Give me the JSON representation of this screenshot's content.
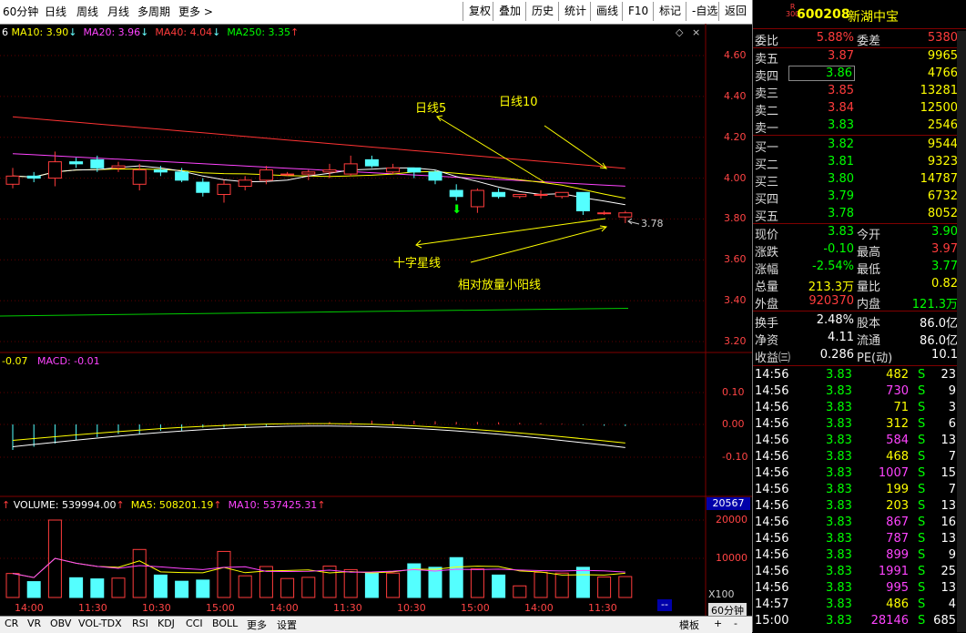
{
  "toolbar": {
    "left": [
      "60分钟",
      "日线",
      "周线",
      "月线",
      "多周期",
      "更多 >"
    ],
    "right": [
      "复权",
      "叠加",
      "历史",
      "统计",
      "画线",
      "F10",
      "标记",
      "-自选",
      "返回"
    ]
  },
  "indicators": {
    "ma_prefix": "6",
    "ma10": "MA10: 3.90",
    "ma20": "MA20: 3.96",
    "ma40": "MA40: 4.04",
    "ma250": "MA250: 3.35",
    "macd_left": "-0.07",
    "macd": "MACD: -0.01",
    "volume": "VOLUME: 539994.00",
    "vma5": "MA5: 508201.19",
    "vma10": "MA10: 537425.31",
    "vol_box": "20567",
    "x100": "X100",
    "period_btn": "60分钟"
  },
  "annotations": {
    "rixian5": "日线5",
    "rixian10": "日线10",
    "shizixing": "十字星线",
    "xiaoyang": "相对放量小阳线",
    "low_label": "3.78"
  },
  "price_axis": [
    "4.60",
    "4.40",
    "4.20",
    "4.00",
    "3.80",
    "3.60",
    "3.40",
    "3.20"
  ],
  "macd_axis": [
    "0.10",
    "0.00",
    "-0.10"
  ],
  "vol_axis": [
    "20000",
    "10000"
  ],
  "time_axis": [
    "14:00",
    "11:30",
    "10:30",
    "15:00",
    "14:00",
    "11:30",
    "10:30",
    "15:00",
    "14:00",
    "11:30"
  ],
  "bottom_tabs": [
    "CR",
    "VR",
    "OBV",
    "VOL-TDX",
    "RSI",
    "KDJ",
    "CCI",
    "BOLL",
    "更多",
    "设置"
  ],
  "bottom_right": [
    "模板",
    "+",
    "-"
  ],
  "colors": {
    "up": "#ff3c3c",
    "down": "#54ffff",
    "ma5": "#ffffff",
    "ma10": "#ffff00",
    "ma20": "#ff44ff",
    "ma40": "#ff3333",
    "ma250": "#00cc00"
  },
  "chart_data": {
    "type": "candlestick",
    "unit": "price (CNY)",
    "ylim": [
      3.2,
      4.6
    ],
    "candles": [
      {
        "o": 3.97,
        "c": 4.01,
        "h": 4.05,
        "l": 3.95
      },
      {
        "o": 4.01,
        "c": 4.0,
        "h": 4.03,
        "l": 3.98
      },
      {
        "o": 4.0,
        "c": 4.08,
        "h": 4.13,
        "l": 3.96
      },
      {
        "o": 4.08,
        "c": 4.07,
        "h": 4.1,
        "l": 4.05
      },
      {
        "o": 4.09,
        "c": 4.05,
        "h": 4.11,
        "l": 4.03
      },
      {
        "o": 4.05,
        "c": 4.06,
        "h": 4.08,
        "l": 4.03
      },
      {
        "o": 3.97,
        "c": 4.04,
        "h": 4.07,
        "l": 3.94
      },
      {
        "o": 4.04,
        "c": 4.03,
        "h": 4.06,
        "l": 4.01
      },
      {
        "o": 4.03,
        "c": 3.99,
        "h": 4.05,
        "l": 3.98
      },
      {
        "o": 3.98,
        "c": 3.93,
        "h": 4.0,
        "l": 3.91
      },
      {
        "o": 3.92,
        "c": 3.97,
        "h": 3.99,
        "l": 3.88
      },
      {
        "o": 3.96,
        "c": 3.99,
        "h": 4.01,
        "l": 3.94
      },
      {
        "o": 3.99,
        "c": 4.04,
        "h": 4.06,
        "l": 3.97
      },
      {
        "o": 4.02,
        "c": 4.02,
        "h": 4.03,
        "l": 4.01
      },
      {
        "o": 4.02,
        "c": 4.03,
        "h": 4.04,
        "l": 3.99
      },
      {
        "o": 4.03,
        "c": 4.04,
        "h": 4.07,
        "l": 4.0
      },
      {
        "o": 4.02,
        "c": 4.07,
        "h": 4.11,
        "l": 4.01
      },
      {
        "o": 4.09,
        "c": 4.06,
        "h": 4.11,
        "l": 4.05
      },
      {
        "o": 4.03,
        "c": 4.05,
        "h": 4.07,
        "l": 4.02
      },
      {
        "o": 4.05,
        "c": 4.03,
        "h": 4.05,
        "l": 4.0
      },
      {
        "o": 4.03,
        "c": 3.99,
        "h": 4.04,
        "l": 3.97
      },
      {
        "o": 3.94,
        "c": 3.91,
        "h": 3.97,
        "l": 3.89
      },
      {
        "o": 3.86,
        "c": 3.94,
        "h": 3.95,
        "l": 3.83
      },
      {
        "o": 3.93,
        "c": 3.91,
        "h": 3.95,
        "l": 3.9
      },
      {
        "o": 3.91,
        "c": 3.92,
        "h": 3.92,
        "l": 3.9
      },
      {
        "o": 3.92,
        "c": 3.92,
        "h": 3.94,
        "l": 3.9
      },
      {
        "o": 3.91,
        "c": 3.93,
        "h": 3.93,
        "l": 3.9
      },
      {
        "o": 3.93,
        "c": 3.84,
        "h": 3.93,
        "l": 3.82
      },
      {
        "o": 3.83,
        "c": 3.83,
        "h": 3.84,
        "l": 3.82
      },
      {
        "o": 3.81,
        "c": 3.83,
        "h": 3.84,
        "l": 3.78
      }
    ],
    "volume": [
      6200,
      4100,
      20000,
      5100,
      4800,
      5000,
      12400,
      5800,
      4200,
      4500,
      11900,
      5600,
      8000,
      4900,
      5200,
      8100,
      7200,
      6300,
      6300,
      8700,
      7800,
      10300,
      7400,
      5800,
      3000,
      6500,
      6300,
      7800,
      5300,
      5400
    ],
    "macd_hist": [
      -0.08,
      -0.07,
      -0.06,
      -0.05,
      -0.04,
      -0.03,
      -0.03,
      -0.02,
      -0.02,
      -0.01,
      -0.01,
      -0.01,
      -0.005,
      0.003,
      0.005,
      0.008,
      0.01,
      0.012,
      0.01,
      0.012,
      0.01,
      0.008,
      0.008,
      0.007,
      0.005,
      0.004,
      0.002,
      -0.002,
      -0.004,
      -0.005
    ]
  },
  "quote": {
    "code": "600208",
    "name": "新湖中宝",
    "badge_top": "R",
    "badge_bottom": "300",
    "weibi_label": "委比",
    "weibi": "5.88%",
    "weicha_label": "委差",
    "weicha": "5380",
    "asks": [
      {
        "label": "卖五",
        "price": "3.87",
        "vol": "9965"
      },
      {
        "label": "卖四",
        "price": "3.86",
        "vol": "4766"
      },
      {
        "label": "卖三",
        "price": "3.85",
        "vol": "13281"
      },
      {
        "label": "卖二",
        "price": "3.84",
        "vol": "12500"
      },
      {
        "label": "卖一",
        "price": "3.83",
        "vol": "2546"
      }
    ],
    "bids": [
      {
        "label": "买一",
        "price": "3.82",
        "vol": "9544"
      },
      {
        "label": "买二",
        "price": "3.81",
        "vol": "9323"
      },
      {
        "label": "买三",
        "price": "3.80",
        "vol": "14787"
      },
      {
        "label": "买四",
        "price": "3.79",
        "vol": "6732"
      },
      {
        "label": "买五",
        "price": "3.78",
        "vol": "8052"
      }
    ],
    "stats": [
      {
        "l1": "现价",
        "v1": "3.83",
        "c1": "grn",
        "l2": "今开",
        "v2": "3.90",
        "c2": "grn"
      },
      {
        "l1": "涨跌",
        "v1": "-0.10",
        "c1": "grn",
        "l2": "最高",
        "v2": "3.97",
        "c2": "red"
      },
      {
        "l1": "涨幅",
        "v1": "-2.54%",
        "c1": "grn",
        "l2": "最低",
        "v2": "3.77",
        "c2": "grn"
      },
      {
        "l1": "总量",
        "v1": "213.3万",
        "c1": "yel",
        "l2": "量比",
        "v2": "0.82",
        "c2": "yel"
      },
      {
        "l1": "外盘",
        "v1": "920370",
        "c1": "red",
        "l2": "内盘",
        "v2": "121.3万",
        "c2": "grn"
      }
    ],
    "stats2": [
      {
        "l1": "换手",
        "v1": "2.48%",
        "l2": "股本",
        "v2": "86.0亿"
      },
      {
        "l1": "净资",
        "v1": "4.11",
        "l2": "流通",
        "v2": "86.0亿"
      },
      {
        "l1": "收益㈢",
        "v1": "0.286",
        "l2": "PE(动)",
        "v2": "10.1"
      }
    ],
    "ticks": [
      {
        "t": "14:56",
        "p": "3.83",
        "v": "482",
        "vc": "yel",
        "s": "S",
        "n": "23"
      },
      {
        "t": "14:56",
        "p": "3.83",
        "v": "730",
        "vc": "mag",
        "s": "S",
        "n": "9"
      },
      {
        "t": "14:56",
        "p": "3.83",
        "v": "71",
        "vc": "yel",
        "s": "S",
        "n": "3"
      },
      {
        "t": "14:56",
        "p": "3.83",
        "v": "312",
        "vc": "yel",
        "s": "S",
        "n": "6"
      },
      {
        "t": "14:56",
        "p": "3.83",
        "v": "584",
        "vc": "mag",
        "s": "S",
        "n": "13"
      },
      {
        "t": "14:56",
        "p": "3.83",
        "v": "468",
        "vc": "yel",
        "s": "S",
        "n": "7"
      },
      {
        "t": "14:56",
        "p": "3.83",
        "v": "1007",
        "vc": "mag",
        "s": "S",
        "n": "15"
      },
      {
        "t": "14:56",
        "p": "3.83",
        "v": "199",
        "vc": "yel",
        "s": "S",
        "n": "7"
      },
      {
        "t": "14:56",
        "p": "3.83",
        "v": "203",
        "vc": "yel",
        "s": "S",
        "n": "13"
      },
      {
        "t": "14:56",
        "p": "3.83",
        "v": "867",
        "vc": "mag",
        "s": "S",
        "n": "16"
      },
      {
        "t": "14:56",
        "p": "3.83",
        "v": "787",
        "vc": "mag",
        "s": "S",
        "n": "13"
      },
      {
        "t": "14:56",
        "p": "3.83",
        "v": "899",
        "vc": "mag",
        "s": "S",
        "n": "9"
      },
      {
        "t": "14:56",
        "p": "3.83",
        "v": "1991",
        "vc": "mag",
        "s": "S",
        "n": "25"
      },
      {
        "t": "14:56",
        "p": "3.83",
        "v": "995",
        "vc": "mag",
        "s": "S",
        "n": "13"
      },
      {
        "t": "14:57",
        "p": "3.83",
        "v": "486",
        "vc": "yel",
        "s": "S",
        "n": "4"
      },
      {
        "t": "15:00",
        "p": "3.83",
        "v": "28146",
        "vc": "mag",
        "s": "S",
        "n": "685"
      }
    ]
  }
}
